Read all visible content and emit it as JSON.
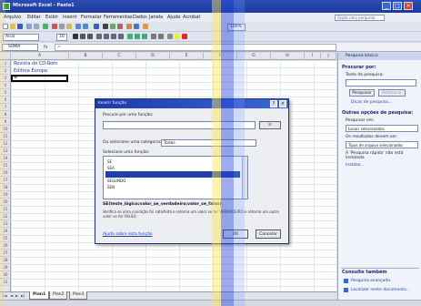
{
  "window": {
    "title": "Microsoft Excel - Pasta1",
    "help_placeholder": "Digite uma pergunta"
  },
  "menu": [
    "Arquivo",
    "Editar",
    "Exibir",
    "Inserir",
    "Formatar",
    "Ferramentas",
    "Dados",
    "Janela",
    "Ajuda",
    "Acrobat"
  ],
  "toolbar": {
    "font": "Arial",
    "size": "10",
    "zoom": "100%"
  },
  "formula_bar": {
    "name_box": "SOMA",
    "fx": "fx",
    "content": "="
  },
  "columns": [
    "A",
    "B",
    "C",
    "D",
    "E",
    "F",
    "G",
    "H",
    "I",
    "J"
  ],
  "rows": [
    "1",
    "2",
    "3",
    "4",
    "5",
    "6",
    "7",
    "8",
    "9",
    "10",
    "11",
    "12",
    "13",
    "14",
    "15",
    "16",
    "17",
    "18",
    "19",
    "20",
    "21",
    "22",
    "23",
    "24",
    "25",
    "26",
    "27",
    "28",
    "29",
    "30",
    "31"
  ],
  "cells": {
    "a1": "Revista do CD-Rom",
    "a2": "Editora Europa",
    "a3": "="
  },
  "sheet_tabs": [
    "Plan1",
    "Plan2",
    "Plan3"
  ],
  "sheet_nav": [
    "|◄",
    "◄",
    "►",
    "►|"
  ],
  "task_pane": {
    "header": "Pesquisa básica",
    "search_heading": "Procurar por:",
    "search_label": "Texto da pesquisa:",
    "search_button": "Pesquisar",
    "restore_button": "Restaurar",
    "tips_link": "Dicas de pesquisa...",
    "other_heading": "Outras opções de pesquisa:",
    "search_in_label": "Pesquisar em:",
    "search_in_value": "Locais selecionados",
    "results_label": "Os resultados devem ser:",
    "results_value": "Tipos de arquivo selecionados",
    "note": "A 'Pesquisa rápida' não está instalada",
    "install_link": "Instalar...",
    "see_also_heading": "Consulte também",
    "link_advanced": "Pesquisa avançada",
    "link_locate": "Localizar neste documento..."
  },
  "dialog": {
    "title": "Inserir função",
    "search_label": "Procure por uma função:",
    "go_button": "Ir",
    "category_label": "Ou selecione uma categoria:",
    "category_value": "Todas",
    "select_label": "Selecione uma função:",
    "functions": [
      "SE",
      "SEA",
      "",
      "SEGUNDO",
      "SEN"
    ],
    "selected_index": 2,
    "signature": "SE(teste_lógico;valor_se_verdadeiro;valor_se_falso)",
    "description": "Verifica se uma condição foi satisfeita e retorna um valor se for VERDADEIRO e retorna um outro valor se for FALSO.",
    "help_link": "Ajuda sobre esta função",
    "ok_button": "OK",
    "cancel_button": "Cancelar"
  }
}
